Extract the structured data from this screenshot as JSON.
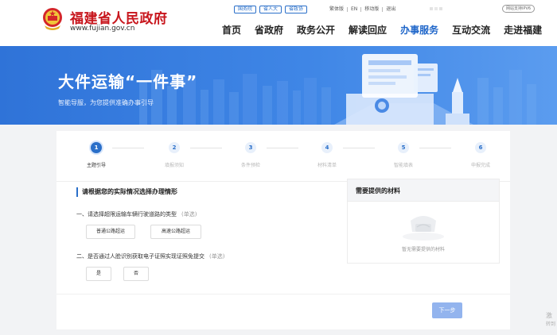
{
  "header": {
    "site_name": "福建省人民政府",
    "site_domain": "www.fujian.gov.cn",
    "top_links": [
      "国务院",
      "省人大",
      "省政协"
    ],
    "util_links": [
      "繁体版",
      "EN",
      "移动版",
      "退出"
    ],
    "ipv6_badge": "网站支持IPV6",
    "nav": [
      {
        "label": "首页",
        "active": false
      },
      {
        "label": "省政府",
        "active": false
      },
      {
        "label": "政务公开",
        "active": false
      },
      {
        "label": "解读回应",
        "active": false
      },
      {
        "label": "办事服务",
        "active": true
      },
      {
        "label": "互动交流",
        "active": false
      },
      {
        "label": "走进福建",
        "active": false
      }
    ]
  },
  "banner": {
    "title": "大件运输“一件事”",
    "subtitle": "智能导服，为您提供准确办事引导"
  },
  "steps": [
    {
      "number": "1",
      "label": "主题引导",
      "active": true
    },
    {
      "number": "2",
      "label": "填报须知",
      "active": false
    },
    {
      "number": "3",
      "label": "条件预检",
      "active": false
    },
    {
      "number": "4",
      "label": "材料清单",
      "active": false
    },
    {
      "number": "5",
      "label": "智能填表",
      "active": false
    },
    {
      "number": "6",
      "label": "申报完成",
      "active": false
    }
  ],
  "form": {
    "section_title": "请根据您的实际情况选择办理情形",
    "questions": [
      {
        "text": "一、请选择超限运输车辆行驶道路的类型",
        "hint": "(单选)",
        "options": [
          "普通公路超运",
          "高速公路超运"
        ]
      },
      {
        "text": "二、是否通过人脸识别获取电子证照实现证照免提交",
        "hint": "(单选)",
        "options": [
          "是",
          "否"
        ]
      }
    ]
  },
  "materials": {
    "title": "需要提供的材料",
    "empty_text": "暂无需要提供的材料"
  },
  "next_button": "下一步",
  "watermark": {
    "line1": "激",
    "line2": "转到"
  },
  "colors": {
    "accent": "#2a6fc9",
    "brand_red": "#c8161d",
    "banner_blue": "#3f86e6"
  }
}
